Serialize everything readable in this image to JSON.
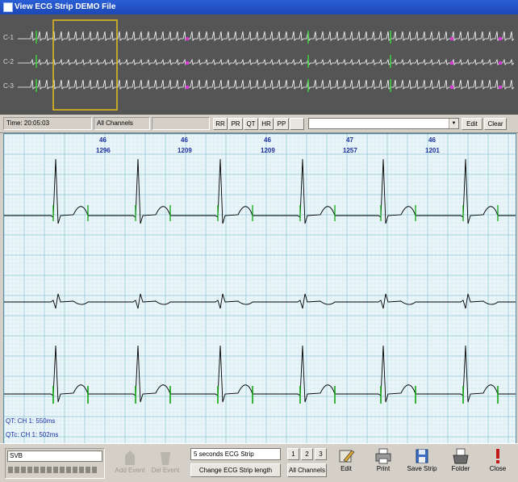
{
  "window": {
    "title": "View ECG Strip  DEMO File"
  },
  "overview": {
    "channels": [
      "C-1",
      "C-2",
      "C-3"
    ]
  },
  "toolbar": {
    "time": "Time: 20:05:03",
    "channel": "All Channels",
    "buttons": [
      "RR",
      "PR",
      "QT",
      "HR",
      "PP"
    ],
    "dropdown_value": "",
    "edit": "Edit",
    "clear": "Clear"
  },
  "strip": {
    "beats": [
      {
        "hr": "46",
        "interval": "1296"
      },
      {
        "hr": "46",
        "interval": "1209"
      },
      {
        "hr": "46",
        "interval": "1209"
      },
      {
        "hr": "47",
        "interval": "1257"
      },
      {
        "hr": "46",
        "interval": "1201"
      }
    ],
    "qt": "QT: CH 1: 550ms",
    "qtc": "QTc: CH 1: 502ms"
  },
  "bottom": {
    "annotation_value": "SVB",
    "add_event": "Add Event",
    "del_event": "Del Event",
    "strip_length": "5 seconds ECG Strip",
    "change_length": "Change ECG Strip length",
    "channels": [
      "1",
      "2",
      "3"
    ],
    "all_channels": "All Channels",
    "actions": [
      "Edit",
      "Print",
      "Save Strip",
      "Folder",
      "Close"
    ]
  },
  "colors": {
    "grid_major": "#8fc4d6",
    "grid_minor": "#cfe8ef",
    "trace": "#000000",
    "marker": "#00a000",
    "highlight": "#e7c21f"
  }
}
